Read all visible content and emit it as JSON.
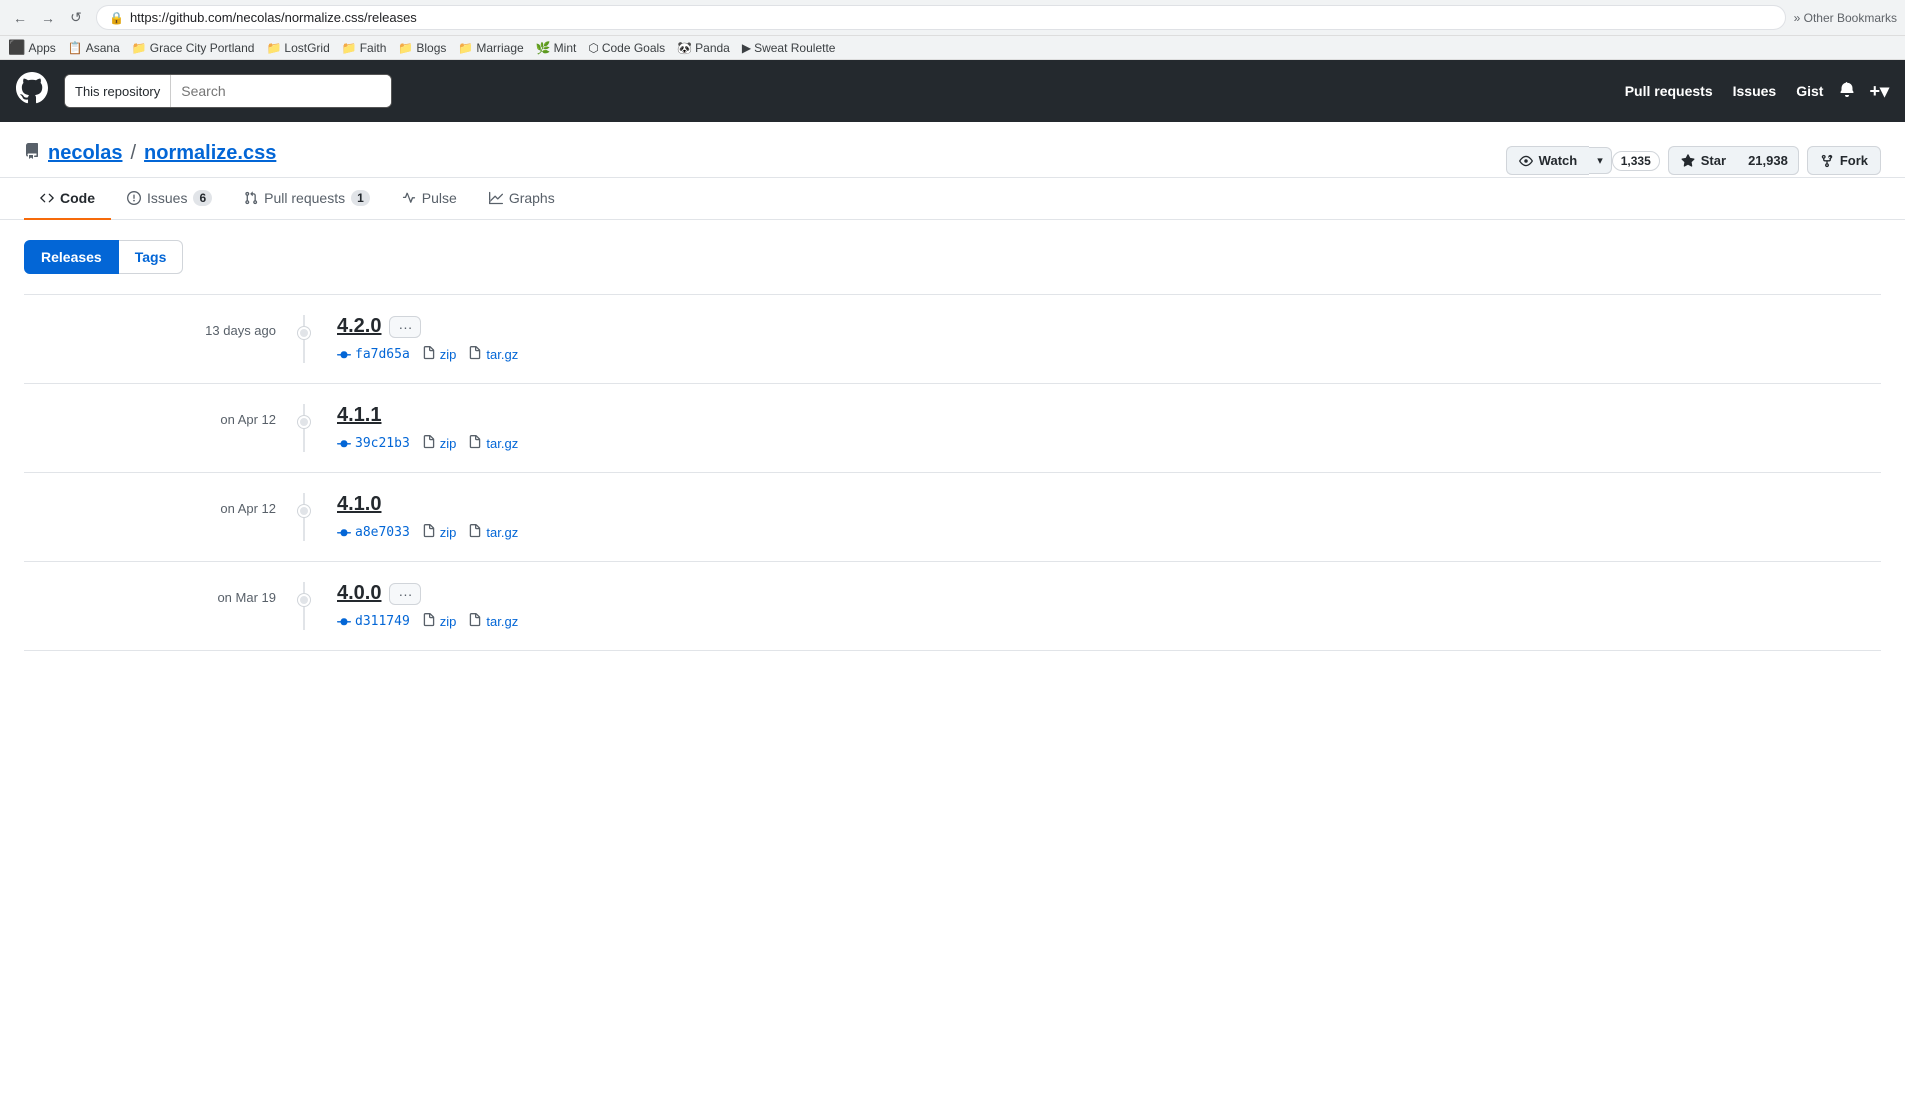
{
  "browser": {
    "back_btn": "←",
    "forward_btn": "→",
    "reload_btn": "↺",
    "url": "https://github.com/necolas/normalize.css/releases",
    "lock_icon": "🔒"
  },
  "bookmarks": {
    "apps_label": "Apps",
    "items": [
      {
        "label": "Asana",
        "icon": "📋"
      },
      {
        "label": "Grace City Portland",
        "icon": "📁"
      },
      {
        "label": "LostGrid",
        "icon": "📁"
      },
      {
        "label": "Faith",
        "icon": "📁"
      },
      {
        "label": "Blogs",
        "icon": "📁"
      },
      {
        "label": "Marriage",
        "icon": "📁"
      },
      {
        "label": "Mint",
        "icon": "🌿"
      },
      {
        "label": "Code Goals",
        "icon": "⬡"
      },
      {
        "label": "Panda",
        "icon": "🐼"
      },
      {
        "label": "Sweat Roulette",
        "icon": "▶"
      }
    ],
    "other_bookmarks": "» Other Bookmarks"
  },
  "header": {
    "logo": "⬤",
    "search_repo_label": "This repository",
    "search_placeholder": "Search",
    "nav_links": [
      {
        "label": "Pull requests"
      },
      {
        "label": "Issues"
      },
      {
        "label": "Gist"
      }
    ],
    "bell_icon": "🔔",
    "plus_icon": "+"
  },
  "repo": {
    "icon": "📋",
    "owner": "necolas",
    "separator": "/",
    "name": "normalize.css",
    "watch_label": "Watch",
    "watch_count": "1,335",
    "star_label": "Star",
    "star_count": "21,938",
    "fork_label": "Fork"
  },
  "tabs": {
    "items": [
      {
        "label": "Code",
        "icon": "<>",
        "active": true
      },
      {
        "label": "Issues",
        "badge": "6"
      },
      {
        "label": "Pull requests",
        "badge": "1"
      },
      {
        "label": "Pulse"
      },
      {
        "label": "Graphs"
      }
    ]
  },
  "releases_tabs": [
    {
      "label": "Releases",
      "active": true
    },
    {
      "label": "Tags",
      "active": false
    }
  ],
  "releases": [
    {
      "date": "13 days ago",
      "version": "4.2.0",
      "has_ellipsis": true,
      "commit": "fa7d65a",
      "assets": [
        "zip",
        "tar.gz"
      ]
    },
    {
      "date": "on Apr 12",
      "version": "4.1.1",
      "has_ellipsis": false,
      "commit": "39c21b3",
      "assets": [
        "zip",
        "tar.gz"
      ]
    },
    {
      "date": "on Apr 12",
      "version": "4.1.0",
      "has_ellipsis": false,
      "commit": "a8e7033",
      "assets": [
        "zip",
        "tar.gz"
      ]
    },
    {
      "date": "on Mar 19",
      "version": "4.0.0",
      "has_ellipsis": true,
      "commit": "d311749",
      "assets": [
        "zip",
        "tar.gz"
      ]
    }
  ]
}
